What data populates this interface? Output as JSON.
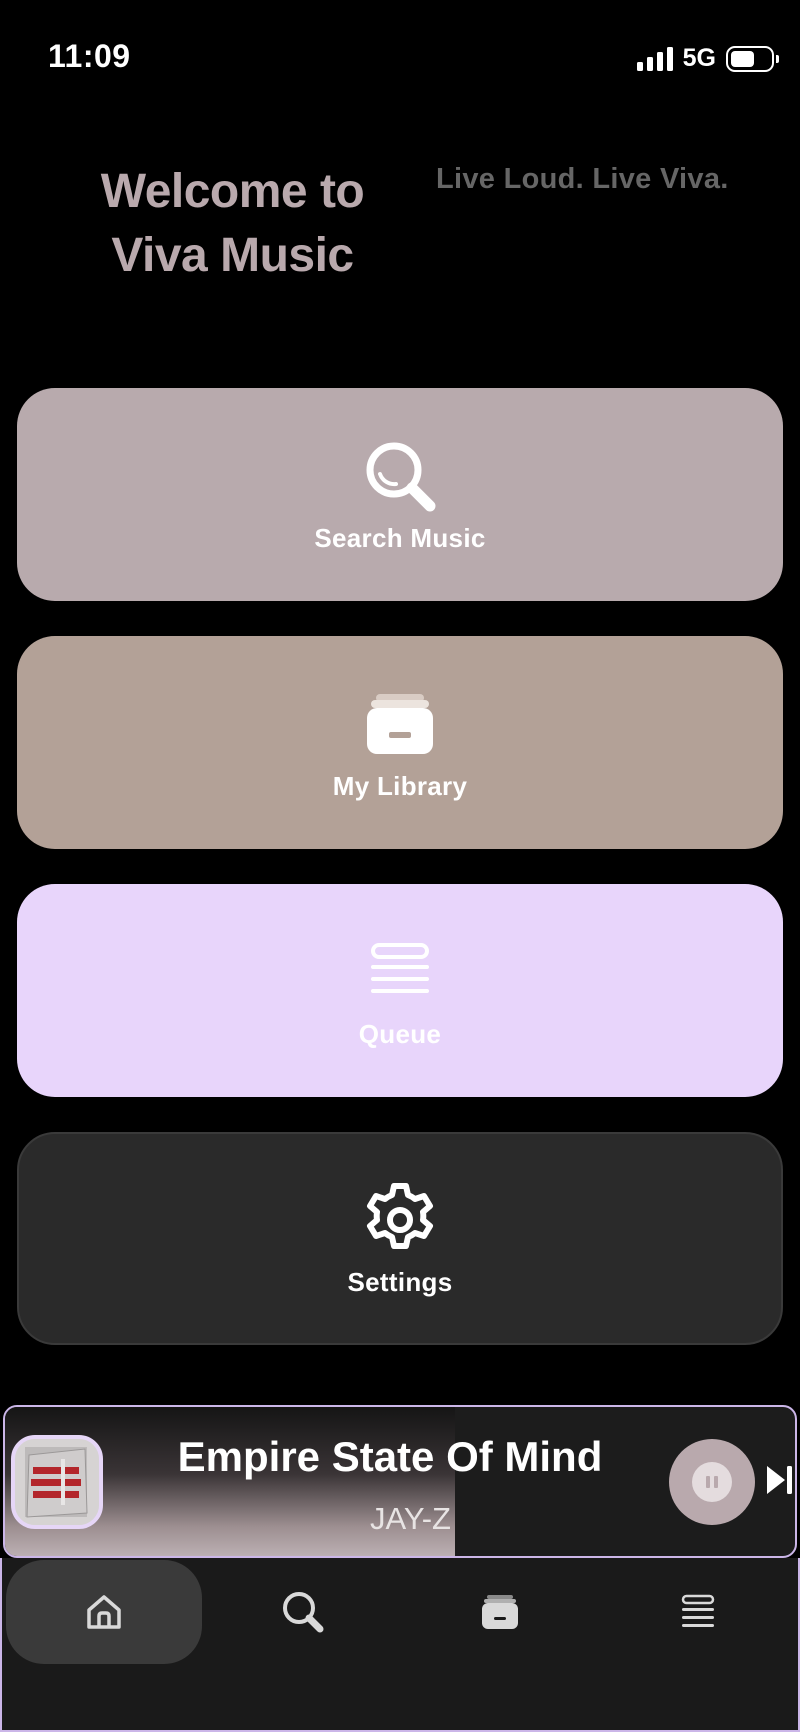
{
  "status_bar": {
    "time": "11:09",
    "network": "5G",
    "battery_level_percent": 60
  },
  "header": {
    "welcome_line1": "Welcome to",
    "welcome_line2": "Viva Music",
    "tagline": "Live Loud. Live Viva."
  },
  "menu": {
    "search": {
      "label": "Search Music",
      "icon": "search-icon",
      "color": "#b8aaad"
    },
    "library": {
      "label": "My Library",
      "icon": "library-icon",
      "color": "#b3a197"
    },
    "queue": {
      "label": "Queue",
      "icon": "queue-icon",
      "color": "#e8d5fb"
    },
    "settings": {
      "label": "Settings",
      "icon": "gear-icon",
      "color": "#2a2a2a"
    }
  },
  "now_playing": {
    "title": "Empire State Of Mind",
    "artist": "JAY-Z",
    "progress_fraction": 0.57,
    "state": "playing",
    "accent_color": "#b9a9ad"
  },
  "tab_bar": {
    "items": [
      {
        "icon": "home-icon",
        "selected": true
      },
      {
        "icon": "search-icon",
        "selected": false
      },
      {
        "icon": "library-icon",
        "selected": false
      },
      {
        "icon": "queue-icon",
        "selected": false
      }
    ]
  }
}
